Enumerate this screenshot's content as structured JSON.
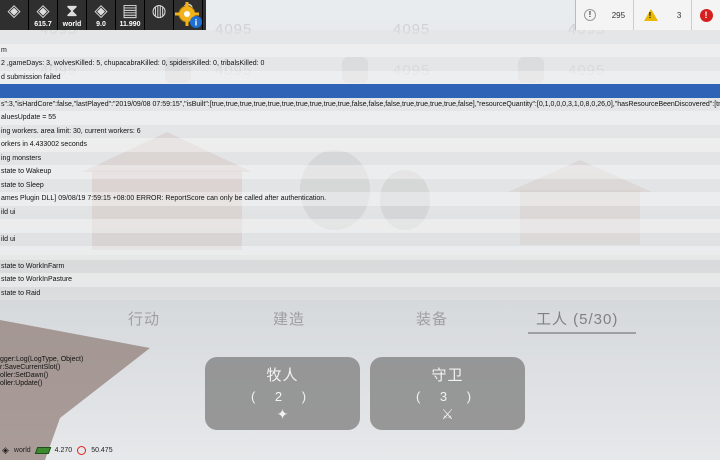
{
  "toolbar": {
    "left_cells": [
      {
        "icon": "unity-logo-icon",
        "glyph": "◈",
        "value": ""
      },
      {
        "icon": "unity-logo-icon",
        "glyph": "◈",
        "value": "615.7"
      },
      {
        "icon": "hourglass-icon",
        "glyph": "⧗",
        "value": "world"
      },
      {
        "icon": "unity-logo-icon",
        "glyph": "◈",
        "value": "9.0"
      },
      {
        "icon": "memory-chip-icon",
        "glyph": "▤",
        "value": "11.990"
      },
      {
        "icon": "speed-gauge-icon",
        "glyph": "◍",
        "value": ""
      },
      {
        "icon": "magnifier-icon",
        "glyph": "⚲",
        "value": ""
      }
    ],
    "settings_icon": "gear-info-icon",
    "counters": {
      "info": "295",
      "warnings": "3"
    }
  },
  "watermarks": [
    "4095",
    "4095",
    "4095",
    "4095",
    "4095",
    "4095",
    "4095",
    "4095"
  ],
  "console": {
    "rows": [
      {
        "text": "",
        "style": "even"
      },
      {
        "text": "m",
        "style": "odd"
      },
      {
        "text": "2 ,gameDays: 3, wolvesKilled: 5, chupacabraKilled: 0, spidersKilled: 0, tribalsKilled: 0",
        "style": "even"
      },
      {
        "text": "d submission failed",
        "style": "odd"
      },
      {
        "text": "",
        "style": "sel"
      },
      {
        "text": "s\":3,\"isHardCore\":false,\"lastPlayed\":\"2019/09/08 07:59:15\",\"isBuilt\":[true,true,true,true,true,true,true,true,true,true,false,false,false,true,true,true,true,false],\"resourceQuantity\":[0,1,0,0,0,3,1,0,8,0,26,0],\"hasResourceBeenDiscovered\":[true,true,tr",
        "style": "even"
      },
      {
        "text": "aluesUpdate = 55",
        "style": "odd"
      },
      {
        "text": "ing workers. area limit: 30, current workers: 6",
        "style": "even"
      },
      {
        "text": "orkers in 4.433002 seconds",
        "style": "odd"
      },
      {
        "text": "ing monsters",
        "style": "even"
      },
      {
        "text": "state to Wakeup",
        "style": "odd"
      },
      {
        "text": "state to Sleep",
        "style": "even"
      },
      {
        "text": "ames Plugin DLL] 09/08/19 7:59:15 +08:00 ERROR: ReportScore can only be called after authentication.",
        "style": "odd"
      },
      {
        "text": "ild ui",
        "style": "even"
      },
      {
        "text": "",
        "style": "odd"
      },
      {
        "text": "ild ui",
        "style": "even"
      },
      {
        "text": "",
        "style": "odd"
      },
      {
        "text": "state to WorkInFarm",
        "style": "even"
      },
      {
        "text": "state to WorkInPasture",
        "style": "odd"
      },
      {
        "text": "state to Raid",
        "style": "even"
      }
    ],
    "stack_trace": [
      "gger:Log(LogType, Object)",
      "r:SaveCurrentSlot()",
      "oller:SetDawn()",
      "oller:Update()"
    ]
  },
  "tabs": [
    {
      "label": "行动",
      "active": false
    },
    {
      "label": "建造",
      "active": false
    },
    {
      "label": "装备",
      "active": false
    },
    {
      "label": "工人 (5/30)",
      "active": true
    }
  ],
  "jobs": [
    {
      "title": "牧人",
      "count": "( 2 )",
      "icon": "pasture-icon",
      "glyph": "✦"
    },
    {
      "title": "守卫",
      "count": "( 3 )",
      "icon": "guard-icon",
      "glyph": "⚔"
    }
  ],
  "statusbar": {
    "world_label": "world",
    "memory_value": "4.270",
    "gauge_value": "50.475"
  },
  "colors": {
    "selection": "#2e63b6",
    "error": "#d62020",
    "warning": "#e9b800"
  }
}
